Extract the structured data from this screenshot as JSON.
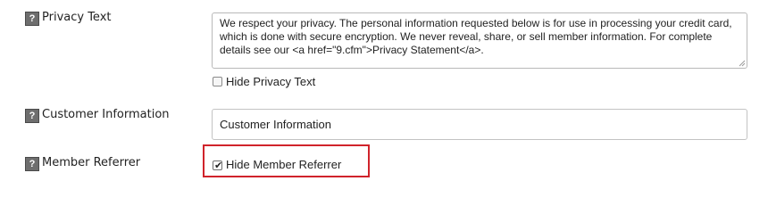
{
  "rows": {
    "privacy_text": {
      "help_icon": "?",
      "label": "Privacy Text",
      "value": "We respect your privacy. The personal information requested below is for use in processing your credit card, which is done with secure encryption.  We never reveal, share, or sell member information. For complete details see our <a href=\"9.cfm\">Privacy Statement</a>.",
      "hide_checkbox": {
        "label": "Hide Privacy Text",
        "checked": false
      }
    },
    "customer_information": {
      "help_icon": "?",
      "label": "Customer Information",
      "value": "Customer Information"
    },
    "member_referrer": {
      "help_icon": "?",
      "label": "Member Referrer",
      "hide_checkbox": {
        "label": "Hide Member Referrer",
        "checked": true
      }
    }
  },
  "colors": {
    "highlight": "#d0232b",
    "help_icon_bg": "#6e6e6e",
    "border": "#b9b9b9"
  },
  "icons": {
    "help": "help-icon",
    "check": "checkmark-icon",
    "resize": "resize-grip-icon"
  }
}
